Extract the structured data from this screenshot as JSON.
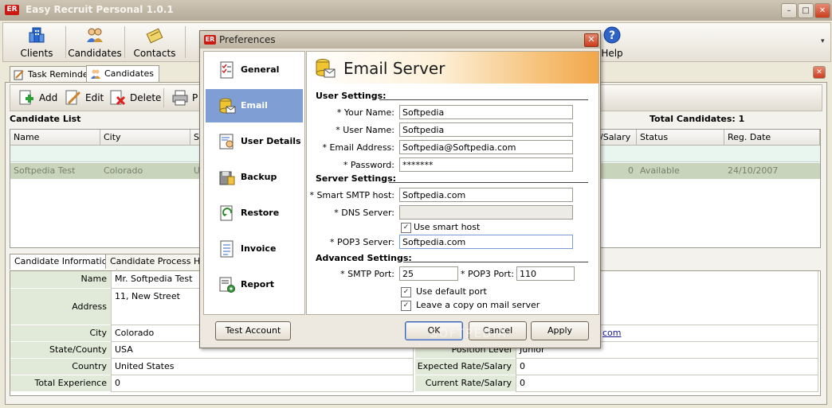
{
  "window": {
    "title": "Easy Recruit Personal 1.0.1",
    "app_icon_text": "ER"
  },
  "toolbar": {
    "items": [
      {
        "label": "Clients",
        "icon": "clients-icon"
      },
      {
        "label": "Candidates",
        "icon": "candidates-icon"
      },
      {
        "label": "Contacts",
        "icon": "contacts-icon"
      },
      {
        "label": "Help",
        "icon": "help-icon"
      }
    ]
  },
  "tabs": [
    {
      "label": "Task Reminder",
      "icon": "task-reminder-icon"
    },
    {
      "label": "Candidates",
      "icon": "candidates-icon"
    }
  ],
  "candidate_toolbar": {
    "add": "Add",
    "edit": "Edit",
    "delete": "Delete",
    "print": "P"
  },
  "candidate_list": {
    "title": "Candidate List",
    "total": "Total Candidates: 1",
    "columns": [
      "Name",
      "City",
      "St",
      "/Salary",
      "Status",
      "Reg. Date"
    ],
    "rows": [
      {
        "name": "Softpedia Test",
        "city": "Colorado",
        "state": "US",
        "salary": "0",
        "status": "Available",
        "reg_date": "24/10/2007"
      }
    ]
  },
  "detail_tabs": [
    "Candidate Information",
    "Candidate Process Histo"
  ],
  "candidate_info": {
    "left": [
      {
        "label": "Name",
        "value": "Mr. Softpedia Test"
      },
      {
        "label": "Address",
        "value": "11, New Street"
      },
      {
        "label": "City",
        "value": "Colorado"
      },
      {
        "label": "State/County",
        "value": "USA"
      },
      {
        "label": "Country",
        "value": "United States"
      },
      {
        "label": "Total Experience",
        "value": "0"
      }
    ],
    "right": [
      {
        "label": "",
        "value": "com"
      },
      {
        "label": "Position Level",
        "value": "Junior"
      },
      {
        "label": "Expected Rate/Salary",
        "value": "0"
      },
      {
        "label": "Current Rate/Salary",
        "value": "0"
      }
    ]
  },
  "preferences": {
    "title": "Preferences",
    "nav": [
      {
        "label": "General",
        "icon": "checklist-icon"
      },
      {
        "label": "Email Server",
        "icon": "email-server-icon"
      },
      {
        "label": "User Details",
        "icon": "user-details-icon"
      },
      {
        "label": "Backup",
        "icon": "backup-icon"
      },
      {
        "label": "Restore",
        "icon": "restore-icon"
      },
      {
        "label": "Invoice",
        "icon": "invoice-icon"
      },
      {
        "label": "Report",
        "icon": "report-icon"
      }
    ],
    "selected": "Email Server",
    "header": "Email Server",
    "user_settings": {
      "title": "User Settings:",
      "your_name": {
        "label": "* Your Name:",
        "value": "Softpedia"
      },
      "user_name": {
        "label": "* User Name:",
        "value": "Softpedia"
      },
      "email": {
        "label": "* Email Address:",
        "value": "Softpedia@Softpedia.com"
      },
      "password": {
        "label": "* Password:",
        "value": "*******"
      }
    },
    "server_settings": {
      "title": "Server Settings:",
      "smtp_host": {
        "label": "* Smart SMTP host:",
        "value": "Softpedia.com"
      },
      "dns_server": {
        "label": "* DNS Server:",
        "value": ""
      },
      "use_smart_host": {
        "label": "Use smart host",
        "checked": true
      },
      "pop3_server": {
        "label": "* POP3  Server:",
        "value": "Softpedia.com"
      }
    },
    "advanced_settings": {
      "title": "Advanced Settings:",
      "smtp_port": {
        "label": "* SMTP Port:",
        "value": "25"
      },
      "pop3_port": {
        "label": "* POP3  Port:",
        "value": "110"
      },
      "use_default_port": {
        "label": "Use default port",
        "checked": true
      },
      "leave_copy": {
        "label": "Leave a copy on mail server",
        "checked": true
      }
    },
    "buttons": {
      "test": "Test Account",
      "ok": "OK",
      "cancel": "Cancel",
      "apply": "Apply"
    }
  },
  "watermark": "SOFTPEDIA"
}
